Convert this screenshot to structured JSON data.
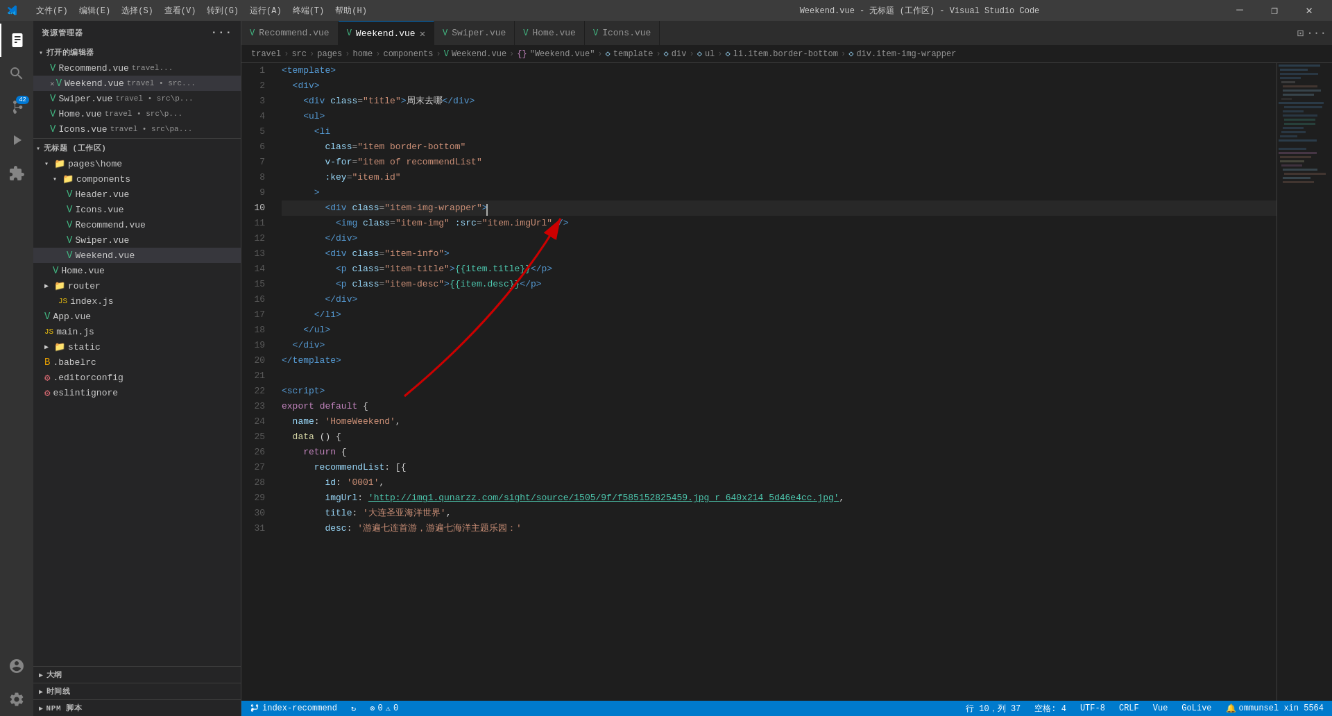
{
  "titleBar": {
    "menus": [
      "文件(F)",
      "编辑(E)",
      "选择(S)",
      "查看(V)",
      "转到(G)",
      "运行(A)",
      "终端(T)",
      "帮助(H)"
    ],
    "title": "Weekend.vue - 无标题 (工作区) - Visual Studio Code",
    "minimize": "─",
    "maximize": "□",
    "close": "✕"
  },
  "activityBar": {
    "icons": [
      "explorer",
      "search",
      "source-control",
      "run-debug",
      "extensions",
      "account",
      "settings"
    ],
    "badge": "42"
  },
  "sidebar": {
    "header": "资源管理器",
    "openEditors": "打开的编辑器",
    "openFiles": [
      {
        "name": "Recommend.vue",
        "path": "travel...",
        "type": "vue",
        "modified": false
      },
      {
        "name": "Weekend.vue",
        "path": "travel • src...",
        "type": "vue",
        "modified": true,
        "active": true
      },
      {
        "name": "Swiper.vue",
        "path": "travel • src\\p...",
        "type": "vue",
        "modified": false
      },
      {
        "name": "Home.vue",
        "path": "travel • src\\p...",
        "type": "vue",
        "modified": false
      },
      {
        "name": "Icons.vue",
        "path": "travel • src\\pa...",
        "type": "vue",
        "modified": false
      }
    ],
    "workspace": "无标题 (工作区)",
    "treeItems": [
      {
        "label": "pages\\home",
        "type": "folder",
        "indent": 1,
        "expanded": true
      },
      {
        "label": "components",
        "type": "folder",
        "indent": 2,
        "expanded": true
      },
      {
        "label": "Header.vue",
        "type": "vue",
        "indent": 3
      },
      {
        "label": "Icons.vue",
        "type": "vue",
        "indent": 3
      },
      {
        "label": "Recommend.vue",
        "type": "vue",
        "indent": 3
      },
      {
        "label": "Swiper.vue",
        "type": "vue",
        "indent": 3
      },
      {
        "label": "Weekend.vue",
        "type": "vue",
        "indent": 3,
        "active": true
      },
      {
        "label": "Home.vue",
        "type": "vue",
        "indent": 2
      },
      {
        "label": "router",
        "type": "folder",
        "indent": 1,
        "expanded": false
      },
      {
        "label": "index.js",
        "type": "js",
        "indent": 2
      },
      {
        "label": "App.vue",
        "type": "vue",
        "indent": 1
      },
      {
        "label": "main.js",
        "type": "js",
        "indent": 1
      },
      {
        "label": "static",
        "type": "folder",
        "indent": 1,
        "expanded": false
      },
      {
        "label": ".babelrc",
        "type": "babelrc",
        "indent": 1
      },
      {
        "label": ".editorconfig",
        "type": "config",
        "indent": 1
      },
      {
        "label": "eslintignore",
        "type": "config",
        "indent": 1
      }
    ],
    "outlineLabel": "大纲",
    "timelineLabel": "时间线",
    "npmLabel": "NPM 脚本"
  },
  "tabs": [
    {
      "name": "Recommend.vue",
      "active": false,
      "type": "vue"
    },
    {
      "name": "Weekend.vue",
      "active": true,
      "type": "vue",
      "closeable": true
    },
    {
      "name": "Swiper.vue",
      "active": false,
      "type": "vue"
    },
    {
      "name": "Home.vue",
      "active": false,
      "type": "vue"
    },
    {
      "name": "Icons.vue",
      "active": false,
      "type": "vue"
    }
  ],
  "breadcrumb": {
    "parts": [
      "travel",
      ">",
      "src",
      ">",
      "pages",
      ">",
      "home",
      ">",
      "components",
      ">",
      "Weekend.vue",
      ">",
      "{} \"Weekend.vue\"",
      ">",
      "template",
      ">",
      "div",
      ">",
      "ul",
      ">",
      "li.item.border-bottom",
      ">",
      "div.item-img-wrapper"
    ]
  },
  "editor": {
    "lines": [
      {
        "num": 1,
        "content": "<template>"
      },
      {
        "num": 2,
        "content": "  <div>"
      },
      {
        "num": 3,
        "content": "    <div class=\"title\">周末去哪</div>"
      },
      {
        "num": 4,
        "content": "    <ul>"
      },
      {
        "num": 5,
        "content": "      <li"
      },
      {
        "num": 6,
        "content": "        class=\"item border-bottom\""
      },
      {
        "num": 7,
        "content": "        v-for=\"item of recommendList\""
      },
      {
        "num": 8,
        "content": "        :key=\"item.id\""
      },
      {
        "num": 9,
        "content": "      >"
      },
      {
        "num": 10,
        "content": "        <div class=\"item-img-wrapper\">",
        "active": true,
        "cursor": true
      },
      {
        "num": 11,
        "content": "          <img class=\"item-img\" :src=\"item.imgUrl\" />"
      },
      {
        "num": 12,
        "content": "        </div>"
      },
      {
        "num": 13,
        "content": "        <div class=\"item-info\">"
      },
      {
        "num": 14,
        "content": "          <p class=\"item-title\">{{item.title}}</p>"
      },
      {
        "num": 15,
        "content": "          <p class=\"item-desc\">{{item.desc}}</p>"
      },
      {
        "num": 16,
        "content": "        </div>"
      },
      {
        "num": 17,
        "content": "      </li>"
      },
      {
        "num": 18,
        "content": "    </ul>"
      },
      {
        "num": 19,
        "content": "  </div>"
      },
      {
        "num": 20,
        "content": "</template>"
      },
      {
        "num": 21,
        "content": ""
      },
      {
        "num": 22,
        "content": "<script>"
      },
      {
        "num": 23,
        "content": "export default {"
      },
      {
        "num": 24,
        "content": "  name: 'HomeWeekend',"
      },
      {
        "num": 25,
        "content": "  data () {"
      },
      {
        "num": 26,
        "content": "    return {"
      },
      {
        "num": 27,
        "content": "      recommendList: [{"
      },
      {
        "num": 28,
        "content": "        id: '0001',"
      },
      {
        "num": 29,
        "content": "        imgUrl: 'http://img1.qunarzz.com/sight/source/1505/9f/f585152825459.jpg_r_640x214_5d46e4cc.jpg',"
      },
      {
        "num": 30,
        "content": "        title: '大连圣亚海洋世界',"
      },
      {
        "num": 31,
        "content": "        desc: '游遍七连首游，游遍七海洋主题乐园：'"
      }
    ]
  },
  "statusBar": {
    "branch": "index-recommend",
    "errors": "0",
    "warnings": "0",
    "row": "行 10，列 37",
    "spaces": "空格: 4",
    "encoding": "UTF-8",
    "lineEnding": "CRLF",
    "language": "Vue",
    "live": "GoLive",
    "notification": "ommunsel xin 5564"
  }
}
